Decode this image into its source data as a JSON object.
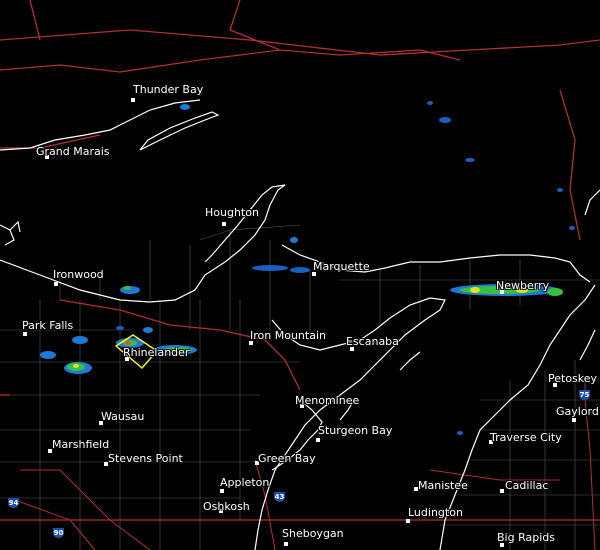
{
  "cities": [
    {
      "name": "Thunder Bay"
    },
    {
      "name": "Grand Marais"
    },
    {
      "name": "Houghton"
    },
    {
      "name": "Marquette"
    },
    {
      "name": "Ironwood"
    },
    {
      "name": "Newberry"
    },
    {
      "name": "Park Falls"
    },
    {
      "name": "Iron Mountain"
    },
    {
      "name": "Rhinelander"
    },
    {
      "name": "Escanaba"
    },
    {
      "name": "Petoskey"
    },
    {
      "name": "Menominee"
    },
    {
      "name": "Gaylord"
    },
    {
      "name": "Wausau"
    },
    {
      "name": "Sturgeon Bay"
    },
    {
      "name": "Traverse City"
    },
    {
      "name": "Marshfield"
    },
    {
      "name": "Stevens Point"
    },
    {
      "name": "Green Bay"
    },
    {
      "name": "Appleton"
    },
    {
      "name": "Manistee"
    },
    {
      "name": "Cadillac"
    },
    {
      "name": "Oshkosh"
    },
    {
      "name": "Ludington"
    },
    {
      "name": "Sheboygan"
    },
    {
      "name": "Big Rapids"
    }
  ],
  "highways": [
    {
      "name": "Interstate 75",
      "label": "75"
    },
    {
      "name": "Interstate 43",
      "label": "43"
    },
    {
      "name": "Interstate 94",
      "label": "94"
    },
    {
      "name": "Interstate 90",
      "label": "90"
    }
  ],
  "colors": {
    "background": "#000000",
    "shoreline": "#ffffff",
    "state_border": "#b03030",
    "county_line": "#555555",
    "warning_polygon": "#ffff00",
    "shield": "#1a4fb0"
  }
}
